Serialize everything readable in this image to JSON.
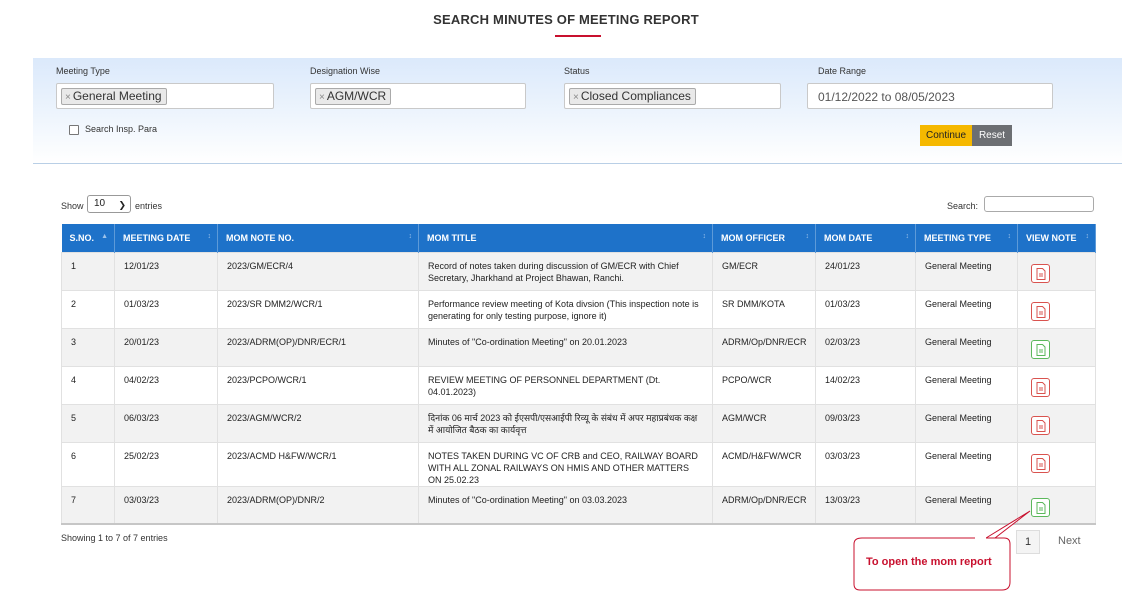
{
  "page": {
    "title": "SEARCH MINUTES OF MEETING REPORT"
  },
  "filters": {
    "meeting_type": {
      "label": "Meeting Type",
      "value": "General Meeting"
    },
    "designation": {
      "label": "Designation Wise",
      "value": "AGM/WCR"
    },
    "status": {
      "label": "Status",
      "value": "Closed Compliances"
    },
    "date_range": {
      "label": "Date Range",
      "value": "01/12/2022 to 08/05/2023"
    },
    "search_insp_para": "Search Insp. Para",
    "continue_label": "Continue",
    "reset_label": "Reset",
    "chip_remove": "×"
  },
  "table_controls": {
    "show_label": "Show",
    "entries_value": "10",
    "entries_label": "entries",
    "search_label": "Search:"
  },
  "table": {
    "headers": [
      "S.NO.",
      "MEETING DATE",
      "MOM NOTE NO.",
      "MOM TITLE",
      "MOM OFFICER",
      "MOM DATE",
      "MEETING TYPE",
      "VIEW NOTE"
    ],
    "rows": [
      {
        "sno": "1",
        "meeting_date": "12/01/23",
        "note_no": "2023/GM/ECR/4",
        "title": "Record of notes taken during discussion of GM/ECR with Chief Secretary, Jharkhand at Project Bhawan, Ranchi.",
        "officer": "GM/ECR",
        "mom_date": "24/01/23",
        "meeting_type": "General Meeting",
        "icon": "pdf-icon",
        "icon_color": "#d9534f"
      },
      {
        "sno": "2",
        "meeting_date": "01/03/23",
        "note_no": "2023/SR DMM2/WCR/1",
        "title": "Performance review meeting of Kota divsion (This inspection note is generating for only testing purpose, ignore it)",
        "officer": "SR DMM/KOTA",
        "mom_date": "01/03/23",
        "meeting_type": "General Meeting",
        "icon": "pdf-icon",
        "icon_color": "#d9534f"
      },
      {
        "sno": "3",
        "meeting_date": "20/01/23",
        "note_no": "2023/ADRM(OP)/DNR/ECR/1",
        "title": "Minutes of \"Co-ordination Meeting\" on 20.01.2023",
        "officer": "ADRM/Op/DNR/ECR",
        "mom_date": "02/03/23",
        "meeting_type": "General Meeting",
        "icon": "doc-icon",
        "icon_color": "#5cb85c"
      },
      {
        "sno": "4",
        "meeting_date": "04/02/23",
        "note_no": "2023/PCPO/WCR/1",
        "title": "REVIEW MEETING OF PERSONNEL DEPARTMENT (Dt. 04.01.2023)",
        "officer": "PCPO/WCR",
        "mom_date": "14/02/23",
        "meeting_type": "General Meeting",
        "icon": "pdf-icon",
        "icon_color": "#d9534f"
      },
      {
        "sno": "5",
        "meeting_date": "06/03/23",
        "note_no": "2023/AGM/WCR/2",
        "title": "दिनांक 06 मार्च 2023 को ईएसपी/एसआईपी रिव्यू के संबंध में अपर महाप्रबंधक कक्ष में आयोजित बैठक का कार्यवृत्त",
        "officer": "AGM/WCR",
        "mom_date": "09/03/23",
        "meeting_type": "General Meeting",
        "icon": "pdf-icon",
        "icon_color": "#d9534f"
      },
      {
        "sno": "6",
        "meeting_date": "25/02/23",
        "note_no": "2023/ACMD H&FW/WCR/1",
        "title": "NOTES TAKEN DURING VC OF CRB and CEO, RAILWAY BOARD WITH ALL ZONAL RAILWAYS ON HMIS AND OTHER MATTERS ON 25.02.23",
        "officer": "ACMD/H&FW/WCR",
        "mom_date": "03/03/23",
        "meeting_type": "General Meeting",
        "icon": "pdf-icon",
        "icon_color": "#d9534f"
      },
      {
        "sno": "7",
        "meeting_date": "03/03/23",
        "note_no": "2023/ADRM(OP)/DNR/2",
        "title": "Minutes of \"Co-ordination Meeting\" on 03.03.2023",
        "officer": "ADRM/Op/DNR/ECR",
        "mom_date": "13/03/23",
        "meeting_type": "General Meeting",
        "icon": "doc-icon",
        "icon_color": "#5cb85c"
      }
    ]
  },
  "footer": {
    "showing": "Showing 1 to 7 of 7 entries",
    "page": "1",
    "next": "Next"
  },
  "callout": {
    "text": "To open the mom report",
    "color": "#c8102e"
  }
}
